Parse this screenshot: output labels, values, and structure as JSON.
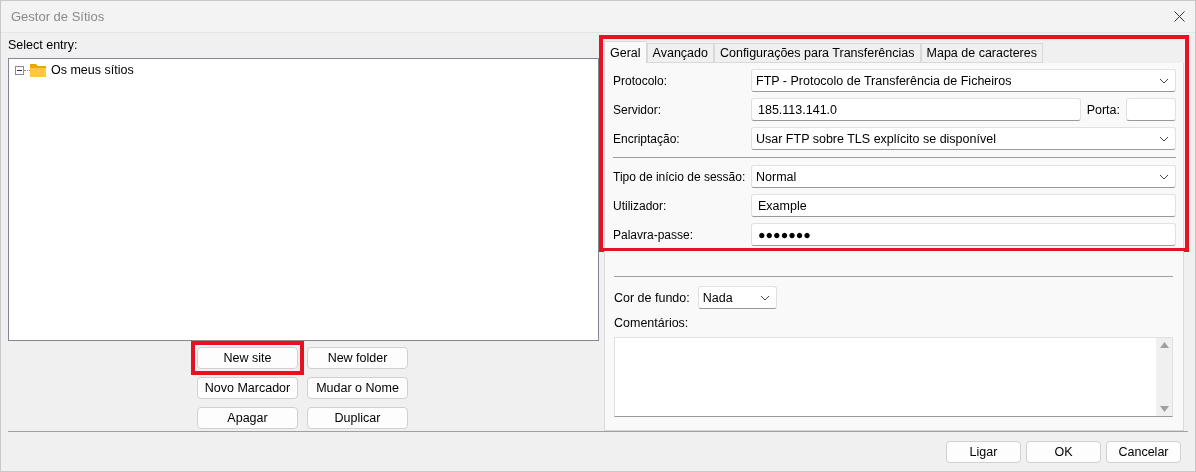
{
  "window": {
    "title": "Gestor de Sítios"
  },
  "site_tree": {
    "label": "Select entry:",
    "items": [
      {
        "label": "Os meus sítios",
        "expanded": true
      }
    ]
  },
  "site_buttons": [
    {
      "label": "New site",
      "highlighted": true
    },
    {
      "label": "New folder",
      "highlighted": false
    },
    {
      "label": "Novo Marcador",
      "highlighted": false
    },
    {
      "label": "Mudar o Nome",
      "highlighted": false
    },
    {
      "label": "Apagar",
      "highlighted": false
    },
    {
      "label": "Duplicar",
      "highlighted": false
    }
  ],
  "tabs": [
    {
      "label": "Geral",
      "selected": true
    },
    {
      "label": "Avançado",
      "selected": false
    },
    {
      "label": "Configurações para Transferências",
      "selected": false
    },
    {
      "label": "Mapa de caracteres",
      "selected": false
    }
  ],
  "general": {
    "highlighted": true,
    "fields": [
      {
        "kind": "select",
        "label": "Protocolo:",
        "value": "FTP - Protocolo de Transferência de Ficheiros"
      },
      {
        "kind": "host",
        "label": "Servidor:",
        "value": "185.113.141.0",
        "port_label": "Porta:"
      },
      {
        "kind": "select",
        "label": "Encriptação:",
        "value": "Usar FTP sobre TLS explícito se disponível"
      },
      {
        "kind": "divider"
      },
      {
        "kind": "select",
        "label": "Tipo de início de sessão:",
        "value": "Normal"
      },
      {
        "kind": "text",
        "label": "Utilizador:",
        "value": "Example"
      },
      {
        "kind": "text",
        "label": "Palavra-passe:",
        "value": "●●●●●●●"
      }
    ]
  },
  "background_color": {
    "label": "Cor de fundo:",
    "value": "Nada"
  },
  "comments": {
    "label": "Comentários:"
  },
  "dialog_buttons": [
    "Ligar",
    "OK",
    "Cancelar"
  ]
}
